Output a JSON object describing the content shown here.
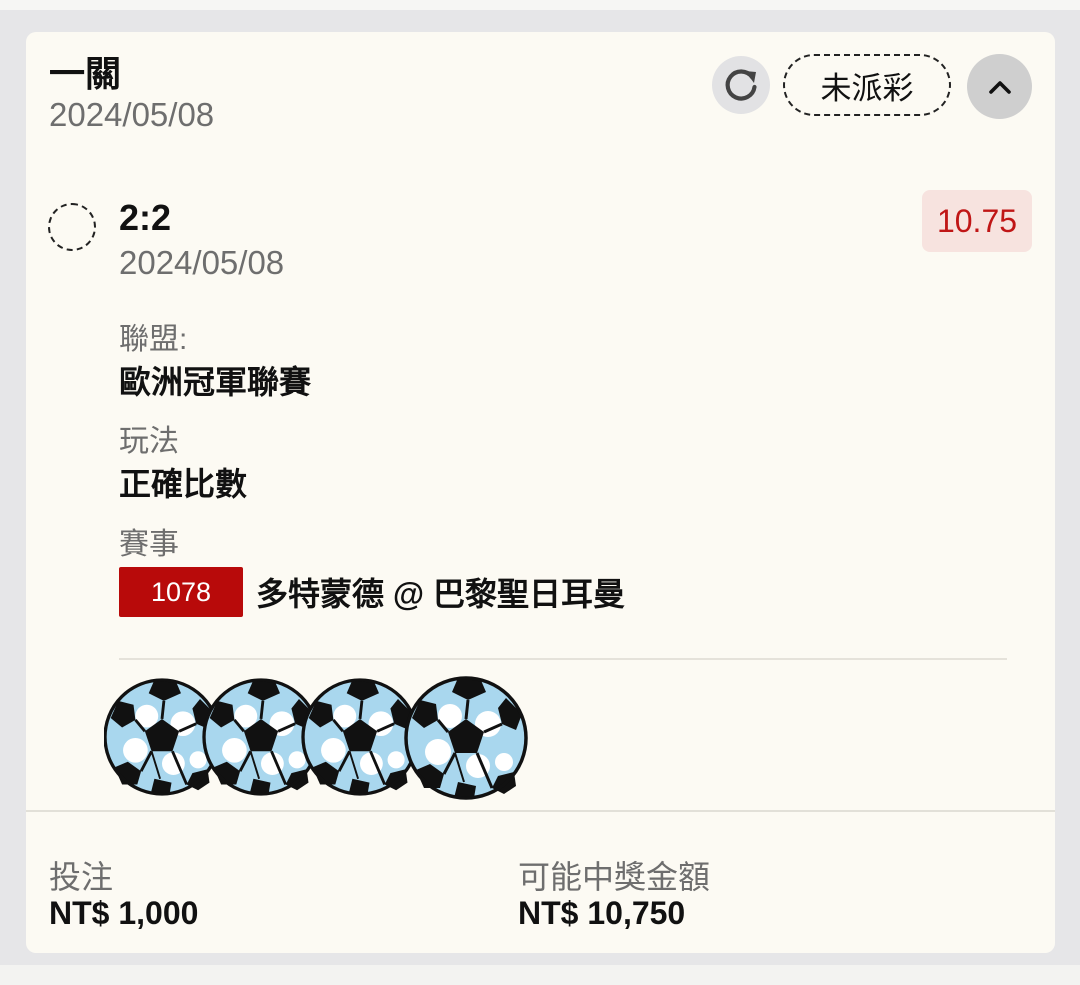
{
  "bet": {
    "type": "一關",
    "date": "2024/05/08",
    "status": "未派彩",
    "refresh_icon": "refresh-icon",
    "collapse_icon": "chevron-up-icon"
  },
  "selection": {
    "pick": "2:2",
    "date": "2024/05/08",
    "odds": "10.75",
    "status_icon": "pending-dashed-circle-icon"
  },
  "details": {
    "league_label": "聯盟:",
    "league": "歐洲冠軍聯賽",
    "market_label": "玩法",
    "market": "正確比數",
    "event_label": "賽事",
    "match_id": "1078",
    "match": "多特蒙德 @ 巴黎聖日耳曼"
  },
  "decoration": {
    "icon": "soccer-ball-icon",
    "count": 4
  },
  "footer": {
    "stake_label": "投注",
    "stake": "NT$ 1,000",
    "payout_label": "可能中獎金額",
    "payout": "NT$ 10,750"
  },
  "colors": {
    "card_bg": "#fcfaf3",
    "page_bg": "#e6e6e8",
    "odds_text": "#c01616",
    "odds_bg": "#f7e3df",
    "match_id_bg": "#b80a0a",
    "ball_patch": "#a9d7ee"
  }
}
